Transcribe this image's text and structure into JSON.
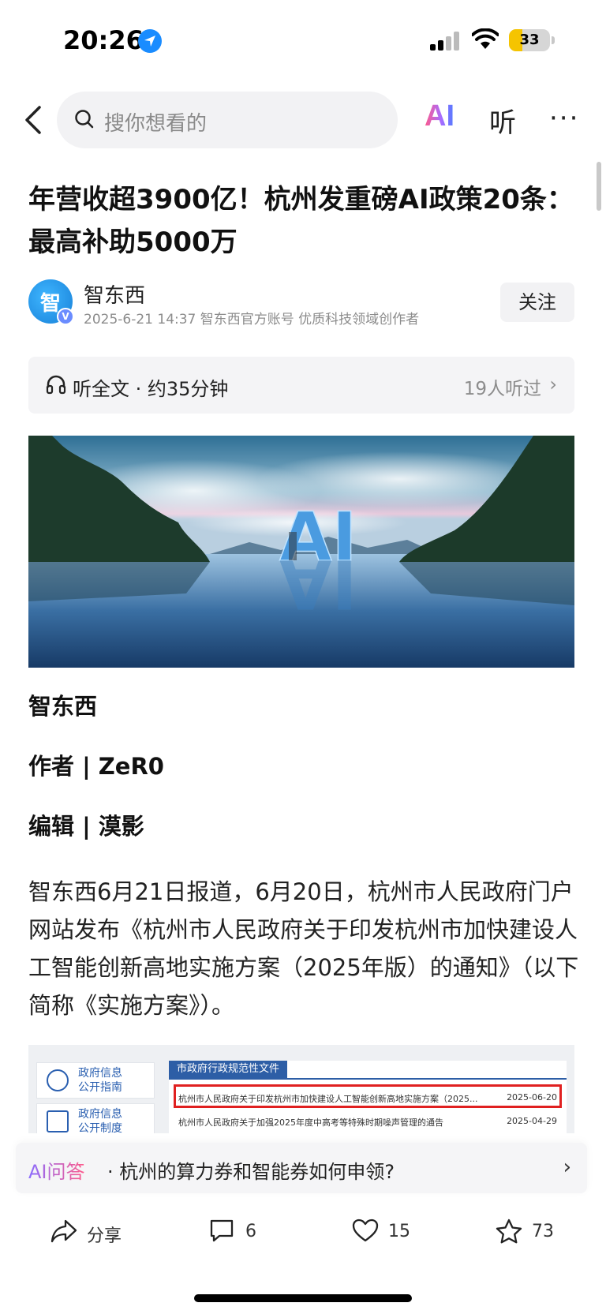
{
  "status_bar": {
    "time": "20:26",
    "battery": "33"
  },
  "nav": {
    "search_placeholder": "搜你想看的",
    "ai_label": "AI",
    "listen_label": "听",
    "more_label": "···"
  },
  "article": {
    "title": "年营收超3900亿！杭州发重磅AI政策20条：最高补助5000万",
    "author": {
      "name": "智东西",
      "avatar_glyph": "智",
      "meta": "2025-6-21 14:37 智东西官方账号 优质科技领域创作者",
      "follow_label": "关注"
    },
    "listen": {
      "label": "听全文 · 约35分钟",
      "count": "19人听过"
    },
    "hero_text": "AI",
    "lines": {
      "source": "智东西",
      "author": "作者 | ZeR0",
      "editor": "编辑 | 漠影"
    },
    "body": "智东西6月21日报道，6月20日，杭州市人民政府门户网站发布《杭州市人民政府关于印发杭州市加快建设人工智能创新高地实施方案（2025年版）的通知》（以下简称《实施方案》）。",
    "doc_image": {
      "side_items": [
        "政府信息\n公开指南",
        "政府信息\n公开制度"
      ],
      "panel_title": "市政府行政规范性文件",
      "rows": [
        {
          "title": "杭州市人民政府关于印发杭州市加快建设人工智能创新高地实施方案（2025...",
          "date": "2025-06-20"
        },
        {
          "title": "杭州市人民政府关于加强2025年度中高考等特殊时期噪声管理的通告",
          "date": "2025-04-29"
        }
      ]
    }
  },
  "ai_qa": {
    "tag": "AI问答",
    "question": "· 杭州的算力券和智能券如何申领?"
  },
  "bottom_bar": {
    "share": "分享",
    "comments": "6",
    "likes": "15",
    "favorites": "73"
  },
  "colors": {
    "accent_blue": "#1a8cff",
    "battery_yellow": "#f5c400",
    "highlight_red": "#e02020"
  }
}
